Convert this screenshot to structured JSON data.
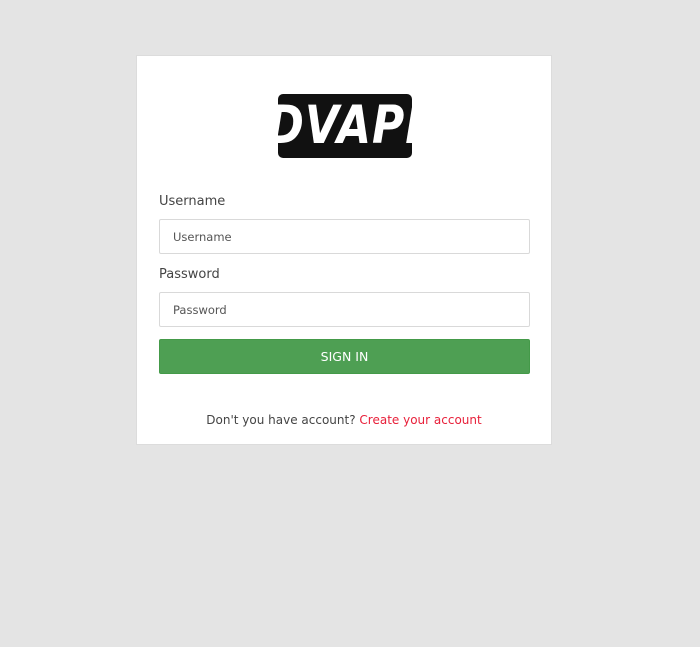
{
  "logo": {
    "text": "DVAPI",
    "background_color": "#111111",
    "text_color": "#ffffff"
  },
  "form": {
    "username": {
      "label": "Username",
      "placeholder": "Username",
      "value": ""
    },
    "password": {
      "label": "Password",
      "placeholder": "Password",
      "value": ""
    },
    "submit_label": "SIGN IN",
    "submit_color": "#4e9f53"
  },
  "footer": {
    "prompt": "Don't you have account?",
    "link_text": "Create your account",
    "link_color": "#e8203a"
  },
  "colors": {
    "page_background": "#e4e4e4",
    "card_background": "#ffffff"
  }
}
